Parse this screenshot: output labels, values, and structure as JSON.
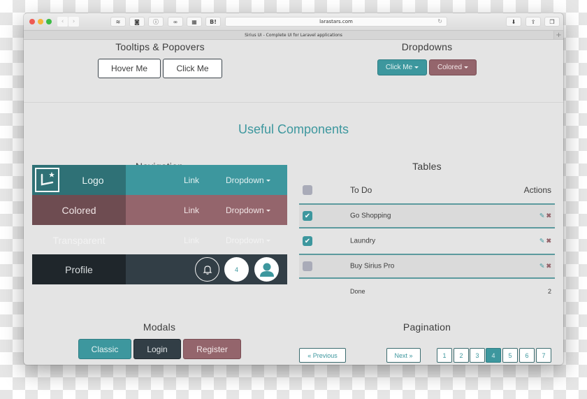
{
  "browser": {
    "url": "larastars.com",
    "tab_title": "Sirius UI - Complete UI for Laravel applications",
    "extensions": [
      "layers-icon",
      "record-icon",
      "info-icon",
      "link-icon",
      "book-icon",
      "hatena-bookmark-icon"
    ],
    "hatena_label": "B!"
  },
  "tooltips": {
    "title": "Tooltips & Popovers",
    "hover_label": "Hover Me",
    "click_label": "Click Me"
  },
  "dropdowns": {
    "title": "Dropdowns",
    "click_label": "Click Me",
    "colored_label": "Colored"
  },
  "useful_title": "Useful Components",
  "navigation": {
    "title": "Navigation",
    "bars": [
      {
        "brand": "Logo",
        "link": "Link",
        "dropdown": "Dropdown"
      },
      {
        "brand": "Colored",
        "link": "Link",
        "dropdown": "Dropdown"
      },
      {
        "brand": "Transparent",
        "link": "Link",
        "dropdown": "Dropdown"
      },
      {
        "brand": "Profile",
        "badge_count": "4"
      }
    ]
  },
  "tables": {
    "title": "Tables",
    "header_todo": "To Do",
    "header_actions": "Actions",
    "rows": [
      {
        "task": "Go Shopping",
        "checked": true
      },
      {
        "task": "Laundry",
        "checked": true
      },
      {
        "task": "Buy Sirius Pro",
        "checked": false
      }
    ],
    "footer_label": "Done",
    "footer_count": "2"
  },
  "modals": {
    "title": "Modals",
    "classic_label": "Classic",
    "login_label": "Login",
    "register_label": "Register"
  },
  "pagination": {
    "title": "Pagination",
    "previous_label": "« Previous",
    "next_label": "Next »",
    "pages": [
      "1",
      "2",
      "3",
      "4",
      "5",
      "6",
      "7"
    ],
    "active_page": "4"
  },
  "colors": {
    "teal": "#3d979e",
    "rose": "#94656c",
    "dark": "#323e46"
  }
}
